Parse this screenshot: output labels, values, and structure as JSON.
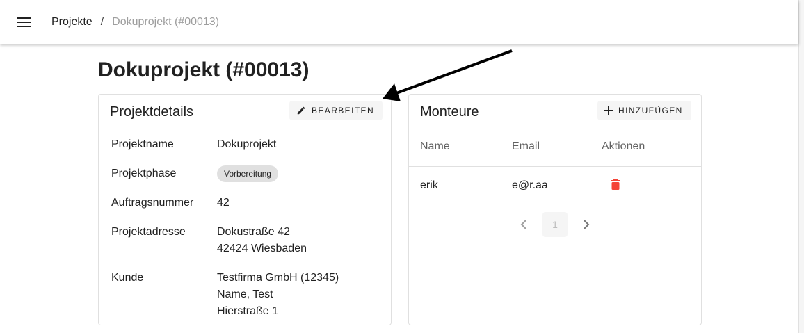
{
  "breadcrumb": {
    "parent": "Projekte",
    "separator": "/",
    "current": "Dokuprojekt (#00013)"
  },
  "page": {
    "title": "Dokuprojekt (#00013)"
  },
  "details": {
    "title": "Projektdetails",
    "edit_label": "Bearbeiten",
    "rows": [
      {
        "label": "Projektname",
        "value": "Dokuprojekt"
      },
      {
        "label": "Projektphase",
        "chip": "Vorbereitung"
      },
      {
        "label": "Auftragsnummer",
        "value": "42"
      },
      {
        "label": "Projektadresse",
        "lines": [
          "Dokustraße 42",
          "42424 Wiesbaden"
        ]
      },
      {
        "label": "Kunde",
        "lines": [
          "Testfirma GmbH (12345)",
          "Name, Test",
          "Hierstraße 1"
        ]
      }
    ]
  },
  "monteure": {
    "title": "Monteure",
    "add_label": "Hinzufügen",
    "columns": [
      "Name",
      "Email",
      "Aktionen"
    ],
    "rows": [
      {
        "name": "erik",
        "email": "e@r.aa"
      }
    ],
    "pagination": {
      "current": "1"
    }
  },
  "icons": {
    "menu": "menu-icon",
    "edit": "pencil-icon",
    "add": "plus-icon",
    "delete": "trash-icon",
    "prev": "chevron-left-icon",
    "next": "chevron-right-icon"
  },
  "colors": {
    "delete": "#f44336",
    "chip": "#e0e0e0",
    "button": "#f5f5f5"
  }
}
